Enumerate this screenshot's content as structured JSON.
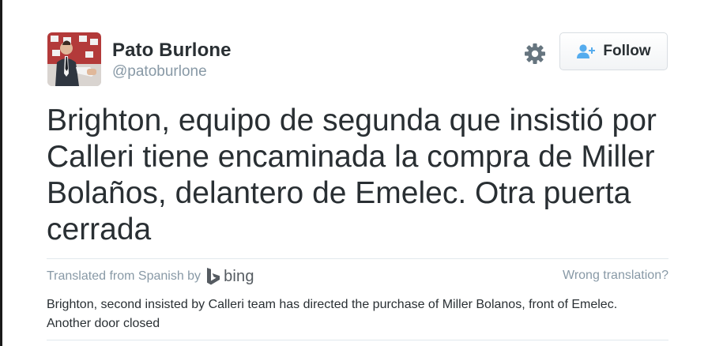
{
  "author": {
    "name": "Pato Burlone",
    "handle": "@patoburlone"
  },
  "actions": {
    "settings_icon": "gear-icon",
    "follow_label": "Follow",
    "follow_icon": "add-user-icon"
  },
  "tweet": {
    "text": "Brighton, equipo de segunda que insistió por\nCalleri tiene encaminada la compra de Miller\nBolaños, delantero de Emelec. Otra puerta\ncerrada"
  },
  "translation": {
    "source_label": "Translated from Spanish by",
    "provider": "bing",
    "wrong_label": "Wrong translation?",
    "text": "Brighton, second insisted by Calleri team has directed the purchase of Miller Bolanos, front of Emelec.\nAnother door closed"
  },
  "colors": {
    "text_primary": "#292f33",
    "text_muted": "#8899a6",
    "divider": "#e1e8ed",
    "follow_icon": "#55acee"
  }
}
